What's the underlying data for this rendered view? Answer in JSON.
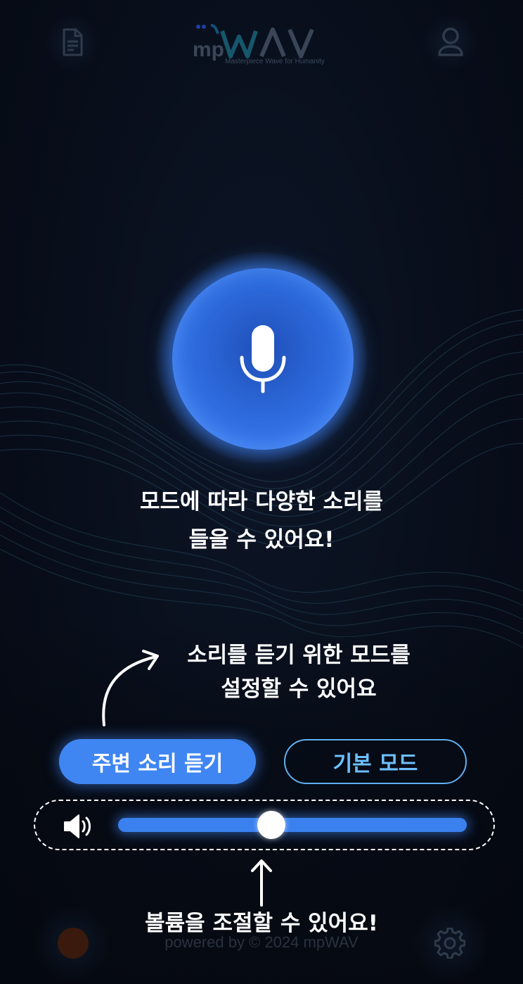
{
  "header": {
    "logo_text": "mpWAV",
    "logo_tagline": "Masterpiece Wave for Humanity",
    "left_icon": "document-icon",
    "right_icon": "profile-icon"
  },
  "mic": {
    "icon": "microphone-icon"
  },
  "main_message": {
    "line1": "모드에 따라 다양한 소리를",
    "line2": "들을 수 있어요!"
  },
  "mode_hint": {
    "line1": "소리를 듣기 위한 모드를",
    "line2": "설정할 수 있어요"
  },
  "modes": {
    "ambient_label": "주변 소리 듣기",
    "basic_label": "기본 모드",
    "selected": "ambient"
  },
  "volume": {
    "icon": "speaker-icon",
    "level_percent": 44
  },
  "volume_hint": "볼륨을 조절할 수 있어요!",
  "footer": "powered by © 2024 mpWAV",
  "bottom": {
    "left_icon": "record-icon",
    "right_icon": "gear-icon"
  },
  "colors": {
    "background": "#080e1a",
    "accent": "#3f86f2",
    "outline": "#5fb0f0",
    "text": "#ffffff"
  }
}
